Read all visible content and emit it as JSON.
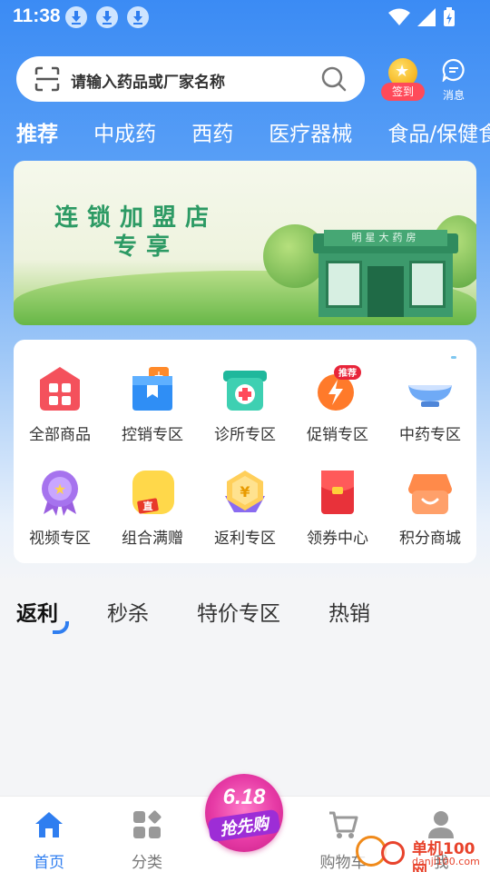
{
  "status_bar": {
    "time": "11:38"
  },
  "search": {
    "placeholder": "请输入药品或厂家名称"
  },
  "signin": {
    "label": "签到"
  },
  "messages": {
    "label": "消息"
  },
  "category_tabs": [
    {
      "label": "推荐"
    },
    {
      "label": "中成药"
    },
    {
      "label": "西药"
    },
    {
      "label": "医疗器械"
    },
    {
      "label": "食品/保健食品"
    }
  ],
  "banner": {
    "line1": "连锁加盟店",
    "line2": "专享",
    "store_sign": "明星大药房"
  },
  "shortcuts": [
    {
      "label": "全部商品",
      "icon": "all-products-icon"
    },
    {
      "label": "控销专区",
      "icon": "controlled-sales-icon"
    },
    {
      "label": "诊所专区",
      "icon": "clinic-icon"
    },
    {
      "label": "促销专区",
      "icon": "promotion-icon",
      "badge": "推荐"
    },
    {
      "label": "中药专区",
      "icon": "chinese-medicine-icon"
    },
    {
      "label": "视频专区",
      "icon": "video-icon"
    },
    {
      "label": "组合满赠",
      "icon": "combo-gift-icon",
      "badge": "直"
    },
    {
      "label": "返利专区",
      "icon": "rebate-icon",
      "badge": "¥"
    },
    {
      "label": "领券中心",
      "icon": "coupon-icon"
    },
    {
      "label": "积分商城",
      "icon": "points-mall-icon"
    }
  ],
  "sub_tabs": [
    {
      "label": "返利"
    },
    {
      "label": "秒杀"
    },
    {
      "label": "特价专区"
    },
    {
      "label": "热销"
    }
  ],
  "bottom_nav": [
    {
      "label": "首页",
      "icon": "home-icon"
    },
    {
      "label": "分类",
      "icon": "category-icon"
    },
    {
      "label": "购物车",
      "icon": "cart-icon"
    },
    {
      "label": "我",
      "icon": "profile-icon"
    }
  ],
  "promo_badge": {
    "number": "6.18",
    "text": "抢先购"
  },
  "watermark": {
    "line1": "单机100网",
    "line2": "danji100.com"
  },
  "colors": {
    "primary": "#2f7ef0",
    "signin_red": "#ff4a5a",
    "promo_pink": "#e63aa5"
  }
}
